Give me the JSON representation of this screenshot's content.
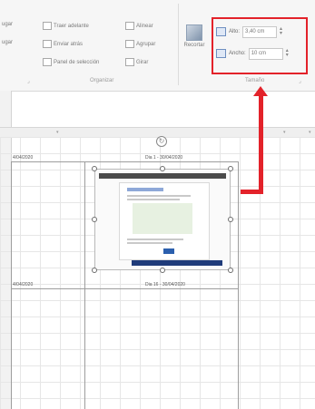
{
  "ribbon": {
    "items": [
      "ugar",
      "ugar",
      "Traer adelante",
      "Enviar atrás",
      "Panel de selección",
      "Alinear",
      "Agrupar",
      "Girar"
    ],
    "recortar_label": "Recortar",
    "groups": {
      "organizar": "Organizar",
      "tamano": "Tamaño"
    },
    "size": {
      "alto_label": "Alto:",
      "alto_value": "3,40 cm",
      "ancho_label": "Ancho:",
      "ancho_value": "10 cm"
    }
  },
  "sheet": {
    "labels": {
      "top_left": "4/04/2020",
      "top_right": "Dia 1 - 30/04/2020",
      "bottom_left": "4/04/2020",
      "bottom_right": "Dia 16 - 30/04/2020"
    }
  },
  "colors": {
    "accent_red": "#e3222a"
  }
}
